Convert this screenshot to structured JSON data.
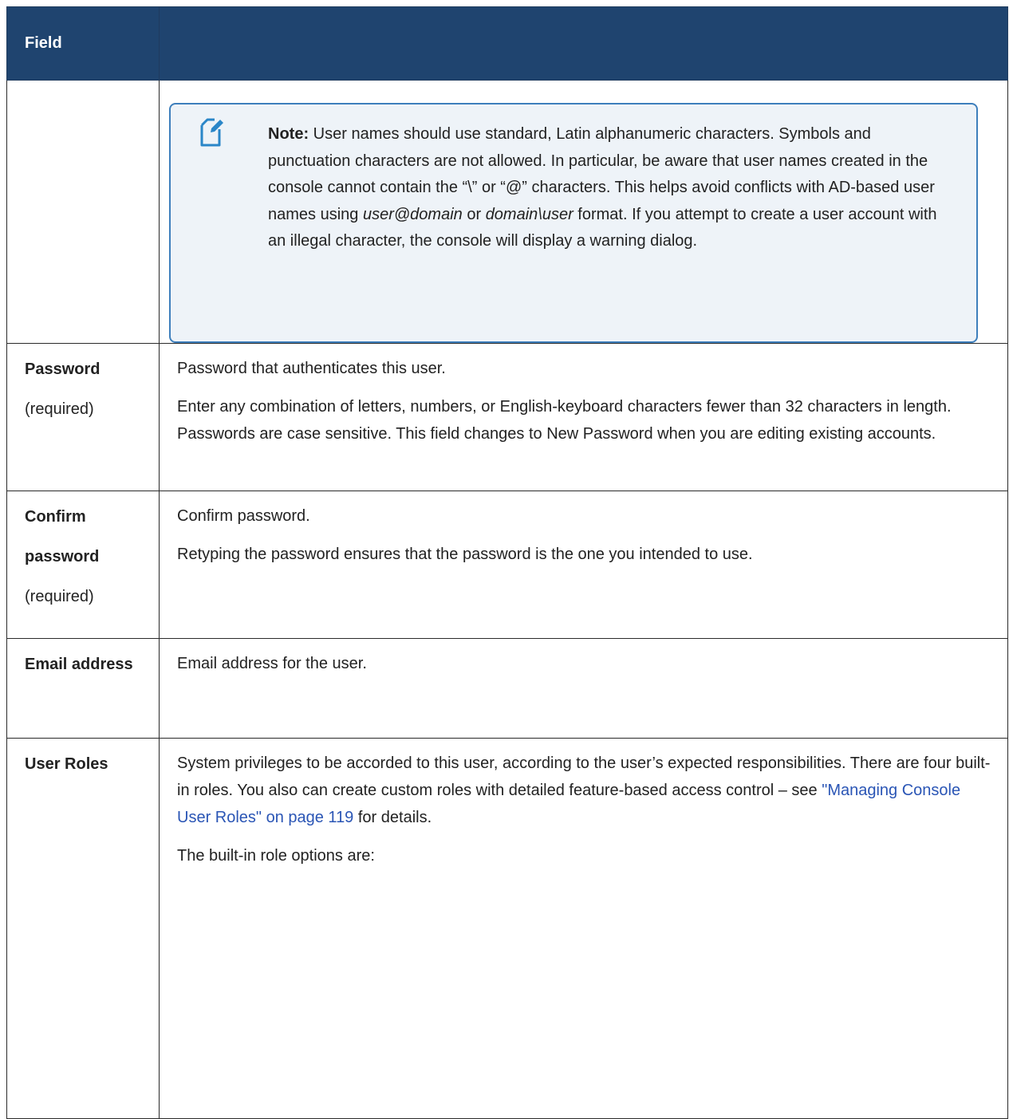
{
  "table": {
    "header_field": "Field",
    "header_description": ""
  },
  "note": {
    "icon": "note-pencil-icon",
    "label": "Note:",
    "text_1": " User names should use standard, Latin alphanumeric characters. Symbols and punctuation characters are not allowed. In particular, be aware that user names created in the console cannot contain the “\\” or “@” characters. This helps avoid conflicts with AD-based user names using ",
    "em_1": "user@domain",
    "text_2": " or ",
    "em_2": "domain\\user",
    "text_3": " format. If you attempt to create a user account with an illegal character, the console will display a warning dialog."
  },
  "rows": {
    "password": {
      "name": "Password",
      "required": "(required)",
      "desc_1": "Password that authenticates this user.",
      "desc_2": "Enter any combination of letters, numbers, or English-keyboard characters fewer than 32 characters in length. Passwords are case sensitive. This field changes to New Password when you are editing existing accounts."
    },
    "confirm": {
      "name": "Confirm password",
      "required": "(required)",
      "desc_1": "Confirm password.",
      "desc_2": "Retyping the password ensures that the password is the one you intended to use."
    },
    "email": {
      "name": "Email address",
      "desc_1": "Email address for the user."
    },
    "roles": {
      "name": "User Roles",
      "desc_1a": "System privileges to be accorded to this user, according to the user’s expected responsibilities. There are four built-in roles. You also can create custom roles with detailed feature-based access control – see ",
      "link": "\"Managing Console User Roles\" on page 119",
      "desc_1b": " for details.",
      "desc_2": "The built-in role options are:"
    }
  },
  "colors": {
    "header_bg": "#1f446f",
    "note_border": "#3e7fbc",
    "note_bg": "#eef3f8",
    "link": "#2a55b5"
  }
}
